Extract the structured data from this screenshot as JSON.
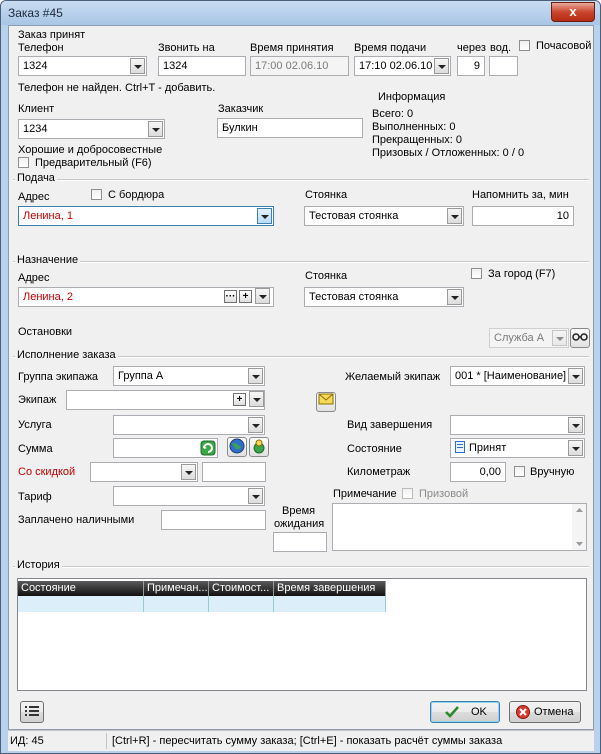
{
  "window": {
    "title": "Заказ #45",
    "close_label": "x"
  },
  "order_accepted": {
    "section": "Заказ принят",
    "phone_label": "Телефон",
    "phone_value": "1324",
    "call_label": "Звонить на",
    "call_value": "1324",
    "accept_time_label": "Время принятия",
    "accept_time_value": "17:00 02.06.10",
    "submit_time_label": "Время подачи",
    "submit_time_value": "17:10 02.06.10",
    "through_label": "через",
    "through_value": "9",
    "driver_label": "вод.",
    "driver_value": "",
    "hourly_label": "Почасовой",
    "phone_hint": "Телефон не найден. Ctrl+T - добавить.",
    "client_label": "Клиент",
    "client_value": "1234",
    "customer_label": "Заказчик",
    "customer_value": "Булкин",
    "client_note": "Хорошие и добросовестные",
    "preliminary_label": "Предварительный (F6)"
  },
  "info": {
    "title": "Информация",
    "total": "Всего: 0",
    "done": "Выполненных: 0",
    "stopped": "Прекращенных: 0",
    "prize": "Призовых / Отложенных: 0 / 0"
  },
  "pickup": {
    "section": "Подача",
    "address_label": "Адрес",
    "from_board_label": "С бордюра",
    "address_value": "Ленина, 1",
    "parking_label": "Стоянка",
    "parking_value": "Тестовая стоянка",
    "remind_label": "Напомнить за, мин",
    "remind_value": "10"
  },
  "destination": {
    "section": "Назначение",
    "address_label": "Адрес",
    "address_value": "Ленина, 2",
    "more_label": "···",
    "plus_label": "+",
    "parking_label": "Стоянка",
    "parking_value": "Тестовая стоянка",
    "out_of_city_label": "За город (F7)",
    "stops_label": "Остановки",
    "service_value": "Служба А"
  },
  "execution": {
    "section": "Исполнение заказа",
    "crew_group_label": "Группа экипажа",
    "crew_group_value": "Группа А",
    "crew_label": "Экипаж",
    "crew_value": "",
    "desired_crew_label": "Желаемый экипаж",
    "desired_crew_value": "001 * [Наименование]",
    "service_label": "Услуга",
    "service_value": "",
    "completion_type_label": "Вид завершения",
    "completion_type_value": "",
    "sum_label": "Сумма",
    "sum_value": "",
    "state_label": "Состояние",
    "state_value": "Принят",
    "discount_label": "Со скидкой",
    "discount_value": "",
    "discount_amount": "",
    "mileage_label": "Километраж",
    "mileage_value": "0,00",
    "manual_label": "Вручную",
    "tariff_label": "Тариф",
    "tariff_value": "",
    "note_label": "Примечание",
    "prize_label": "Призовой",
    "paid_cash_label": "Заплачено наличными",
    "paid_cash_value": "",
    "wait_time_label_1": "Время",
    "wait_time_label_2": "ожидания",
    "wait_time_value": ""
  },
  "history": {
    "section": "История",
    "columns": [
      "Состояние",
      "Примечан...",
      "Стоимост...",
      "Время завершения"
    ]
  },
  "buttons": {
    "ok": "OK",
    "cancel": "Отмена"
  },
  "status": {
    "id": "ИД: 45",
    "hint": "[Ctrl+R] - пересчитать сумму заказа; [Ctrl+E] - показать расчёт суммы заказа"
  },
  "colors": {
    "accent_red": "#c00000",
    "title_bg": "#b9d1ea"
  }
}
